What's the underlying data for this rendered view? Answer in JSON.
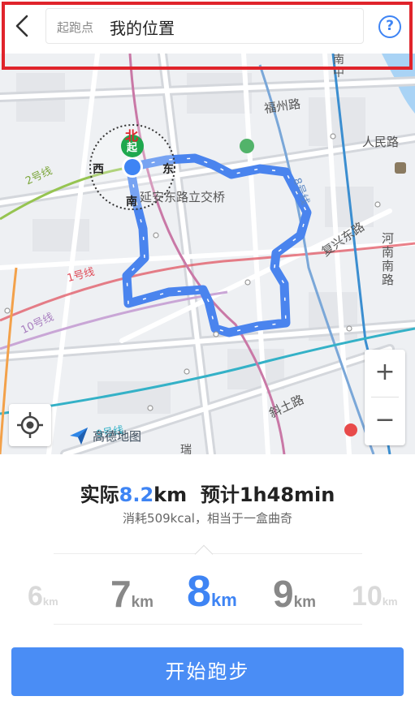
{
  "header": {
    "start_label": "起跑点",
    "start_value": "我的位置",
    "help_symbol": "?"
  },
  "map": {
    "labels": {
      "fuzhou_road": "福州路",
      "peoples_road": "人民路",
      "yanan_interchange": "延安东路立交桥",
      "fuxing_road": "复兴东路",
      "henan_south_road": "河南南路",
      "xietu_road": "斜土路",
      "nanzhong": "南中",
      "line2": "2号线",
      "line1": "1号线",
      "line8": "8号线",
      "line10": "10号线",
      "line9": "9号线",
      "compass_north": "北",
      "compass_south": "南",
      "compass_east": "东",
      "compass_west": "西",
      "start_marker": "起",
      "partial_bottom": "瑞"
    },
    "zoom_in": "+",
    "zoom_out": "−",
    "logo_text": "高德地图",
    "route_color": "#4a84ee"
  },
  "summary": {
    "actual_prefix": "实际",
    "actual_distance": "8.2",
    "actual_unit": "km",
    "estimate_prefix": "预计",
    "estimate_time": "1h48min",
    "calories_line": "消耗509kcal，相当于一盒曲奇"
  },
  "distance_picker": {
    "options": [
      {
        "num": "6",
        "unit": "km"
      },
      {
        "num": "7",
        "unit": "km"
      },
      {
        "num": "8",
        "unit": "km",
        "selected": true
      },
      {
        "num": "9",
        "unit": "km"
      },
      {
        "num": "10",
        "unit": "km"
      }
    ]
  },
  "start_button": "开始跑步",
  "colors": {
    "accent": "#3e84f4",
    "highlight_box": "#e0242b"
  }
}
